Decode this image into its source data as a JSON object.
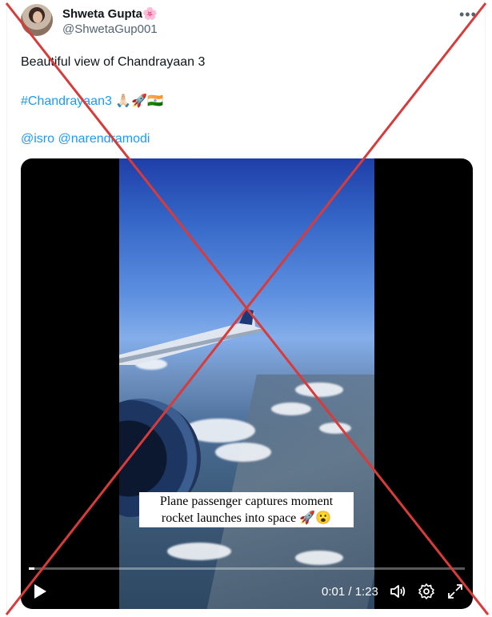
{
  "author": {
    "name": "Shweta Gupta",
    "name_emoji": "🌸",
    "handle": "@ShwetaGup001"
  },
  "post": {
    "text": "Beautiful view of Chandrayaan 3",
    "hashtag": "#Chandrayaan3",
    "emojis": "🙏🏻🚀🇮🇳",
    "mention_1": "@isro",
    "mention_2": "@narendramodi"
  },
  "video": {
    "caption_line1": "Plane passenger captures moment",
    "caption_line2": "rocket launches into space 🚀😮",
    "time_display": "0:01 / 1:23",
    "progress_fraction": 0.012
  },
  "icons": [
    "more-icon",
    "play-icon",
    "volume-icon",
    "settings-gear-icon",
    "fullscreen-icon"
  ],
  "colors": {
    "link": "#1d9bf0",
    "cross": "#d93a3a",
    "handle": "#536471"
  }
}
